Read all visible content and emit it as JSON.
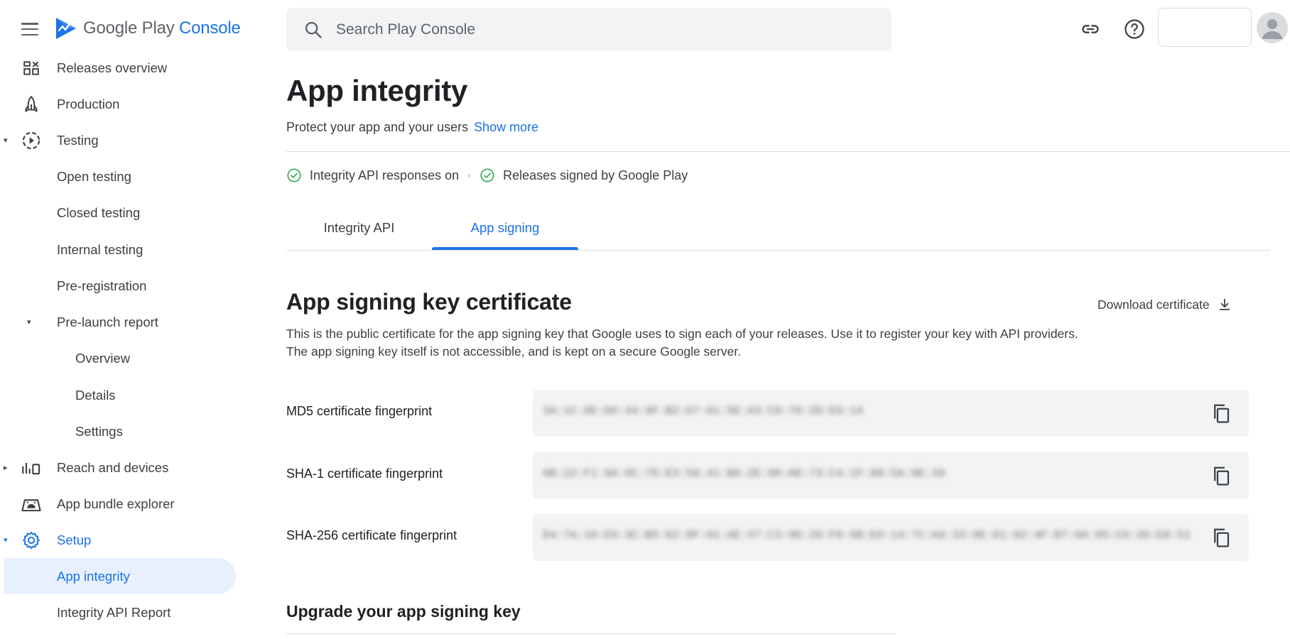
{
  "app": {
    "logo_word1": "Google Play",
    "logo_word2": "Console"
  },
  "search": {
    "placeholder": "Search Play Console"
  },
  "sidebar": {
    "items": [
      {
        "label": "Releases overview"
      },
      {
        "label": "Production"
      },
      {
        "label": "Testing"
      },
      {
        "label": "Open testing"
      },
      {
        "label": "Closed testing"
      },
      {
        "label": "Internal testing"
      },
      {
        "label": "Pre-registration"
      },
      {
        "label": "Pre-launch report"
      },
      {
        "label": "Overview"
      },
      {
        "label": "Details"
      },
      {
        "label": "Settings"
      },
      {
        "label": "Reach and devices"
      },
      {
        "label": "App bundle explorer"
      },
      {
        "label": "Setup"
      },
      {
        "label": "App integrity"
      },
      {
        "label": "Integrity API Report"
      }
    ]
  },
  "page": {
    "title": "App integrity",
    "subtitle": "Protect your app and your users",
    "show_more": "Show more",
    "statuses": [
      "Integrity API responses on",
      "Releases signed by Google Play"
    ]
  },
  "tabs": [
    {
      "label": "Integrity API"
    },
    {
      "label": "App signing"
    }
  ],
  "signing": {
    "title": "App signing key certificate",
    "download_label": "Download certificate",
    "description": "This is the public certificate for the app signing key that Google uses to sign each of your releases. Use it to register your key with API providers. The app signing key itself is not accessible, and is kept on a secure Google server.",
    "fingerprints": [
      {
        "label": "MD5 certificate fingerprint",
        "value": "3A:1C:8E:D0:44:9F:B2:07:61:5E:A3:C9:70:2D:E8:14"
      },
      {
        "label": "SHA-1 certificate fingerprint",
        "value": "6B:22:F1:9A:0C:7D:E3:58:41:B6:2E:90:AD:73:C4:1F:88:5A:0E:39"
      },
      {
        "label": "SHA-256 certificate fingerprint",
        "value": "D4:7A:10:E9:3C:B5:62:8F:01:AE:47:C3:9D:26:F8:5B:E0:14:7C:A9:33:6E:D1:82:4F:B7:0A:95:C6:2D:E8:51"
      }
    ]
  },
  "upgrade": {
    "title": "Upgrade your app signing key"
  },
  "colors": {
    "accent": "#1a73e8",
    "success": "#34a853",
    "active_bg": "#e8f0fe"
  }
}
